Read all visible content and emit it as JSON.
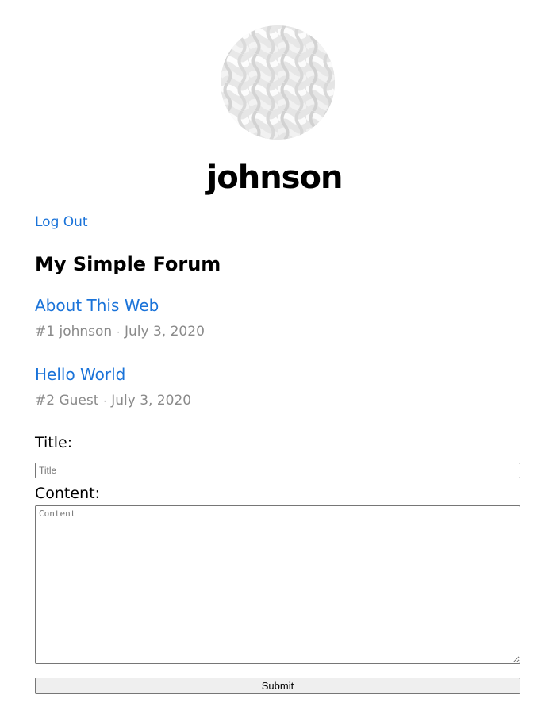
{
  "profile": {
    "username": "johnson",
    "avatar_icon": "woven-pattern-avatar"
  },
  "nav": {
    "logout_label": "Log Out"
  },
  "site": {
    "title": "My Simple Forum"
  },
  "posts": [
    {
      "title": "About This Web",
      "number": "#1",
      "author": "johnson",
      "separator": "·",
      "date": "July 3, 2020"
    },
    {
      "title": "Hello World",
      "number": "#2",
      "author": "Guest",
      "separator": "·",
      "date": "July 3, 2020"
    }
  ],
  "form": {
    "title_label": "Title:",
    "title_placeholder": "Title",
    "content_label": "Content:",
    "content_placeholder": "Content",
    "submit_label": "Submit"
  },
  "colors": {
    "link": "#1a73d9",
    "meta_text": "#8a8a8a",
    "button_bg": "#efefef"
  }
}
